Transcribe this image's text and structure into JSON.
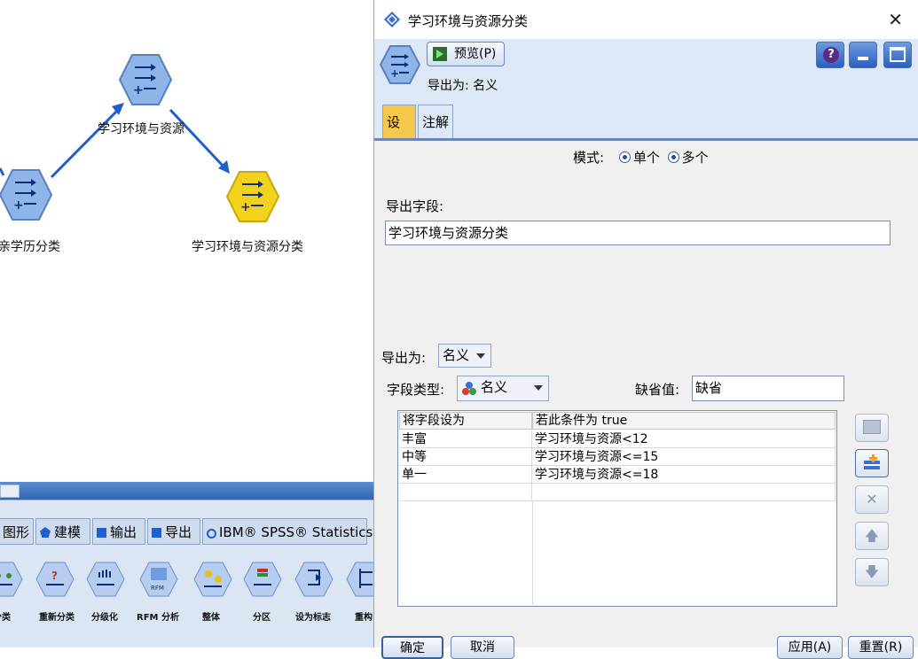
{
  "canvas": {
    "nodes": [
      {
        "label": "学习环境与资源"
      },
      {
        "label": "亲学历分类"
      },
      {
        "label": "学习环境与资源分类"
      }
    ]
  },
  "palette": {
    "tabs": [
      "图形",
      "建模",
      "输出",
      "导出",
      "IBM® SPSS® Statistics"
    ],
    "nodes": [
      "分类",
      "重新分类",
      "分级化",
      "RFM 分析",
      "整体",
      "分区",
      "设为标志",
      "重构"
    ]
  },
  "dialog": {
    "title": "学习环境与资源分类",
    "preview_label": "预览(P)",
    "export_as_header": "导出为: 名义",
    "tabs": [
      "设置",
      "注解"
    ],
    "mode_label": "模式:",
    "mode_options": [
      "单个",
      "多个"
    ],
    "mode_selected": "单个",
    "derive_field_label": "导出字段:",
    "derive_field_value": "学习环境与资源分类",
    "derive_as_label": "导出为:",
    "derive_as_value": "名义",
    "field_type_label": "字段类型:",
    "field_type_value": "名义",
    "default_label": "缺省值:",
    "default_value": "缺省",
    "table": {
      "headers": [
        "将字段设为",
        "若此条件为 true"
      ],
      "rows": [
        [
          "丰富",
          "学习环境与资源<12"
        ],
        [
          "中等",
          "学习环境与资源<=15"
        ],
        [
          "单一",
          "学习环境与资源<=18"
        ]
      ]
    },
    "buttons": {
      "ok": "确定",
      "cancel": "取消",
      "apply": "应用(A)",
      "reset": "重置(R)"
    }
  },
  "colors": {
    "node_blue": "#8fb4e8",
    "node_selected": "#f2d21c",
    "connector": "#1f5fc7",
    "active_tab": "#f5c84a"
  }
}
